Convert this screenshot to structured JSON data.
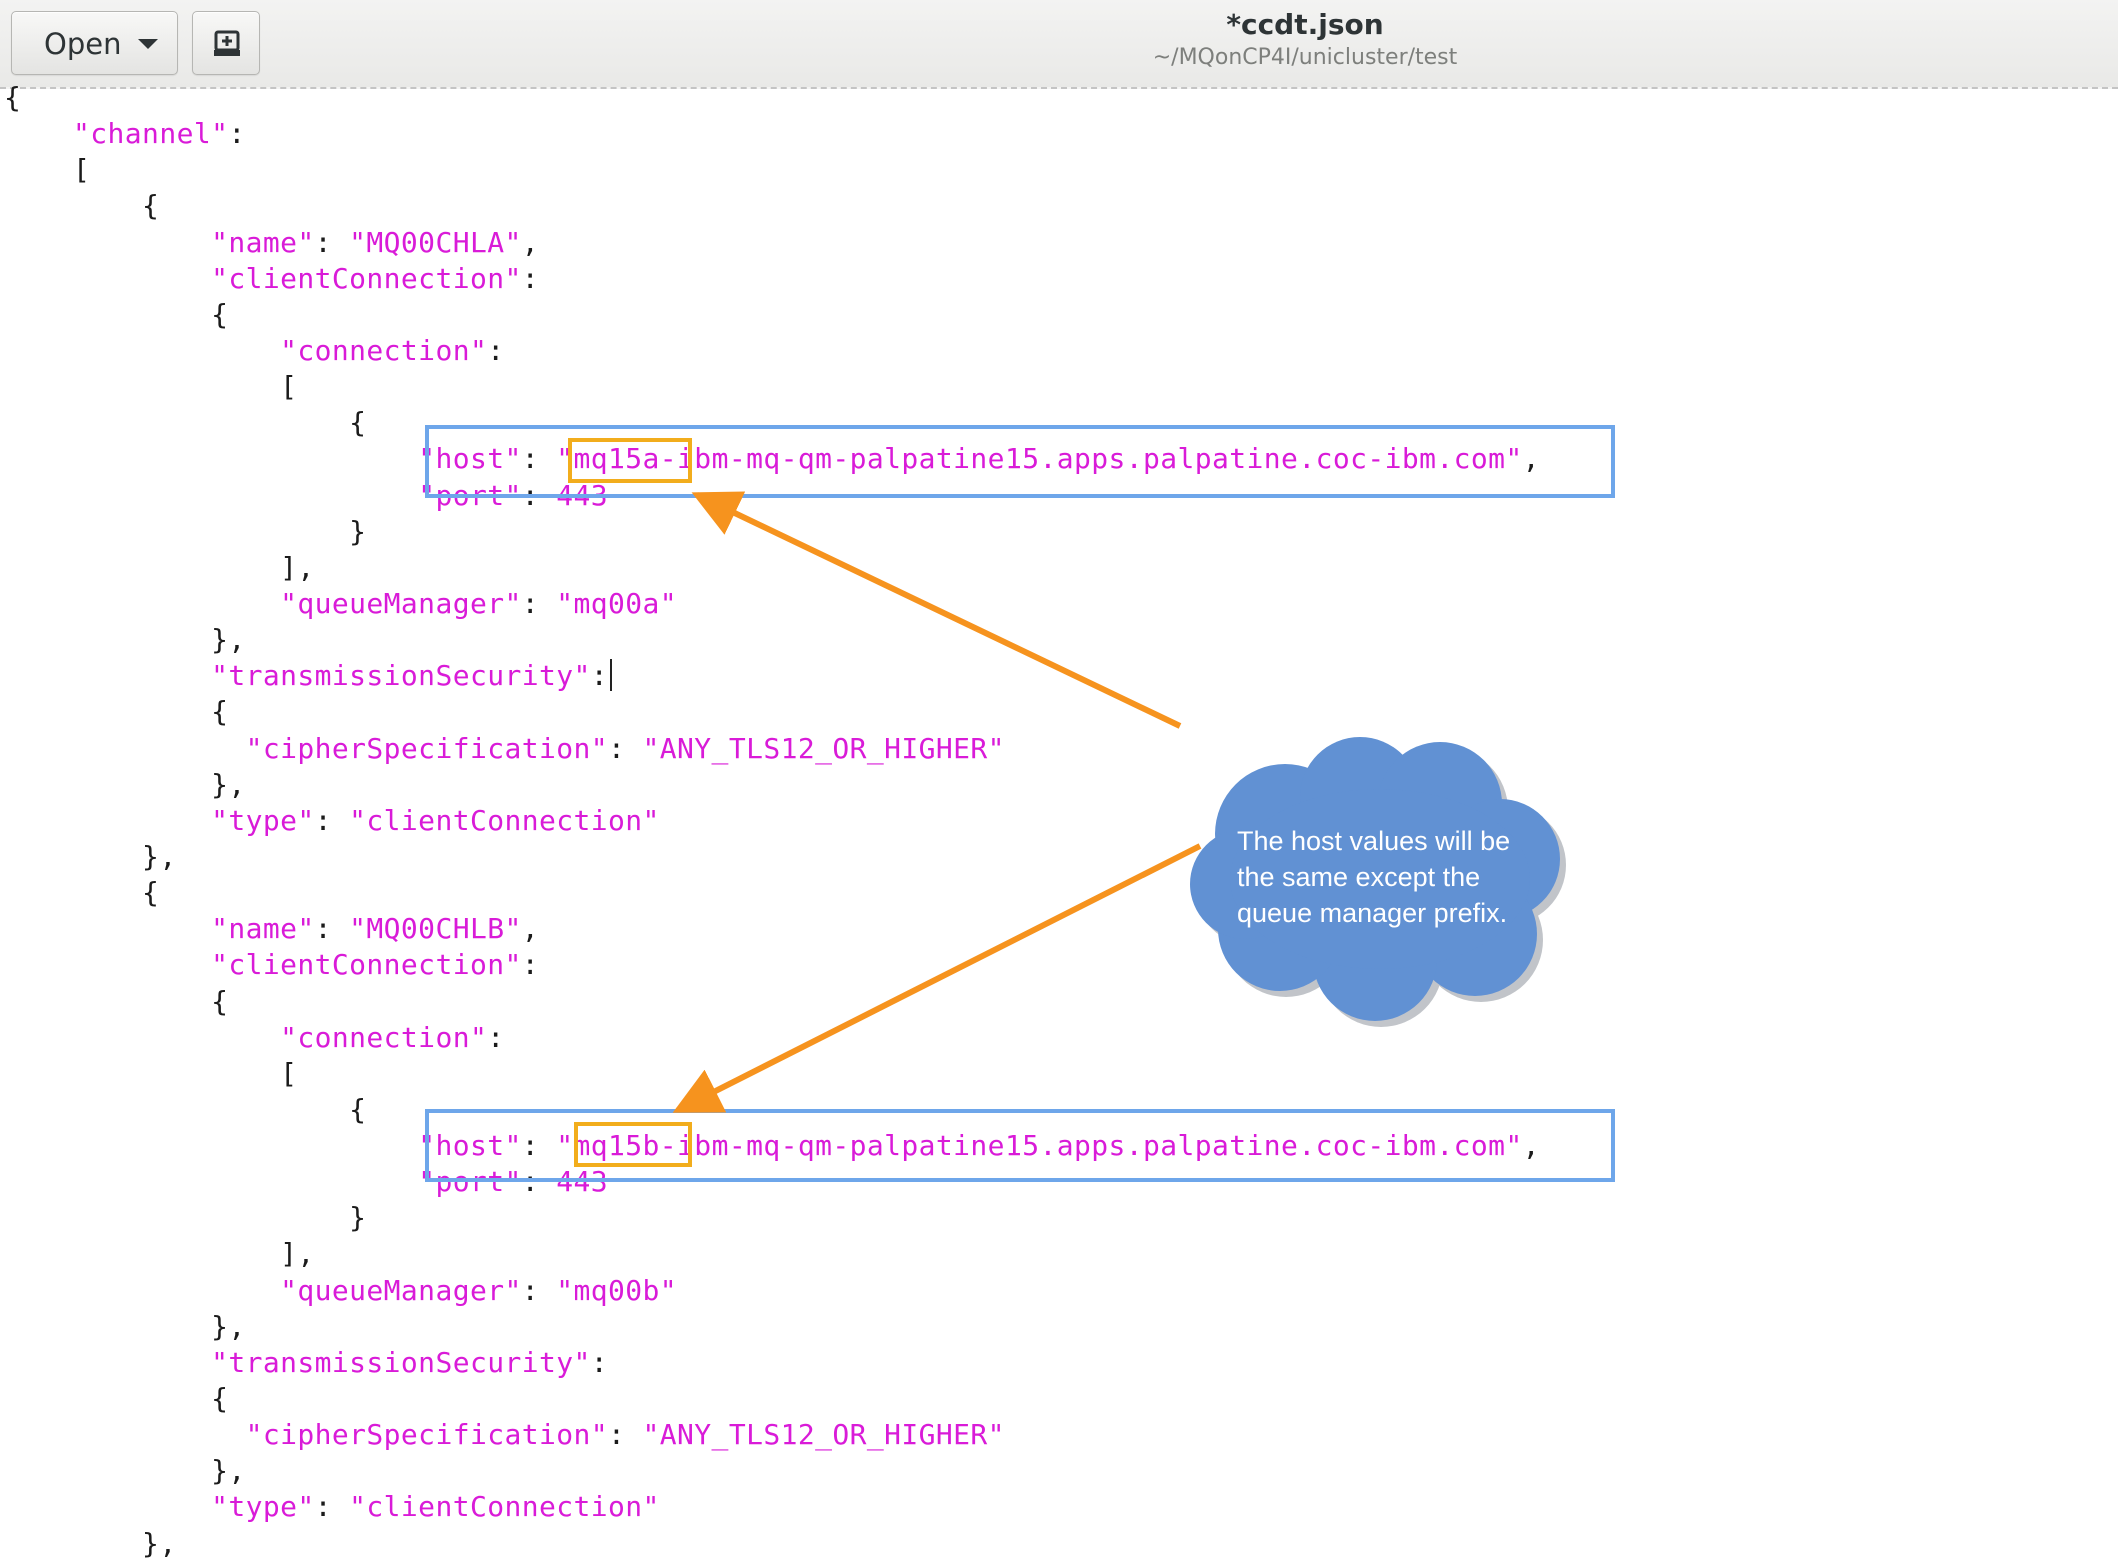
{
  "toolbar": {
    "open_label": "Open",
    "open_dropdown_icon": "chevron-down-icon",
    "new_document_icon": "new-document-icon"
  },
  "window": {
    "title": "*ccdt.json",
    "path": "~/MQonCP4I/unicluster/test"
  },
  "code_lines": [
    "{",
    "    \"channel\":",
    "    [",
    "        {",
    "            \"name\": \"MQ00CHLA\",",
    "            \"clientConnection\":",
    "            {",
    "                \"connection\":",
    "                [",
    "                    {",
    "                        \"host\": \"mq15a-ibm-mq-qm-palpatine15.apps.palpatine.coc-ibm.com\",",
    "                        \"port\": 443",
    "                    }",
    "                ],",
    "                \"queueManager\": \"mq00a\"",
    "            },",
    "            \"transmissionSecurity\":",
    "            {",
    "              \"cipherSpecification\": \"ANY_TLS12_OR_HIGHER\"",
    "            },",
    "            \"type\": \"clientConnection\"",
    "        },",
    "        {",
    "            \"name\": \"MQ00CHLB\",",
    "            \"clientConnection\":",
    "            {",
    "                \"connection\":",
    "                [",
    "                    {",
    "                        \"host\": \"mq15b-ibm-mq-qm-palpatine15.apps.palpatine.coc-ibm.com\",",
    "                        \"port\": 443",
    "                    }",
    "                ],",
    "                \"queueManager\": \"mq00b\"",
    "            },",
    "            \"transmissionSecurity\":",
    "            {",
    "              \"cipherSpecification\": \"ANY_TLS12_OR_HIGHER\"",
    "            },",
    "            \"type\": \"clientConnection\"",
    "        },"
  ],
  "annotation": {
    "callout_text": "The host values will be the same except the queue manager prefix.",
    "colors": {
      "highlight_box": "#6ea6ea",
      "prefix_box": "#f2ad1c",
      "arrow": "#f6931e",
      "cloud_fill": "#6191d3",
      "cloud_text": "#ffffff"
    }
  },
  "syntax_colors": {
    "string": "#d91bd8",
    "punctuation": "#1b1b1b"
  }
}
